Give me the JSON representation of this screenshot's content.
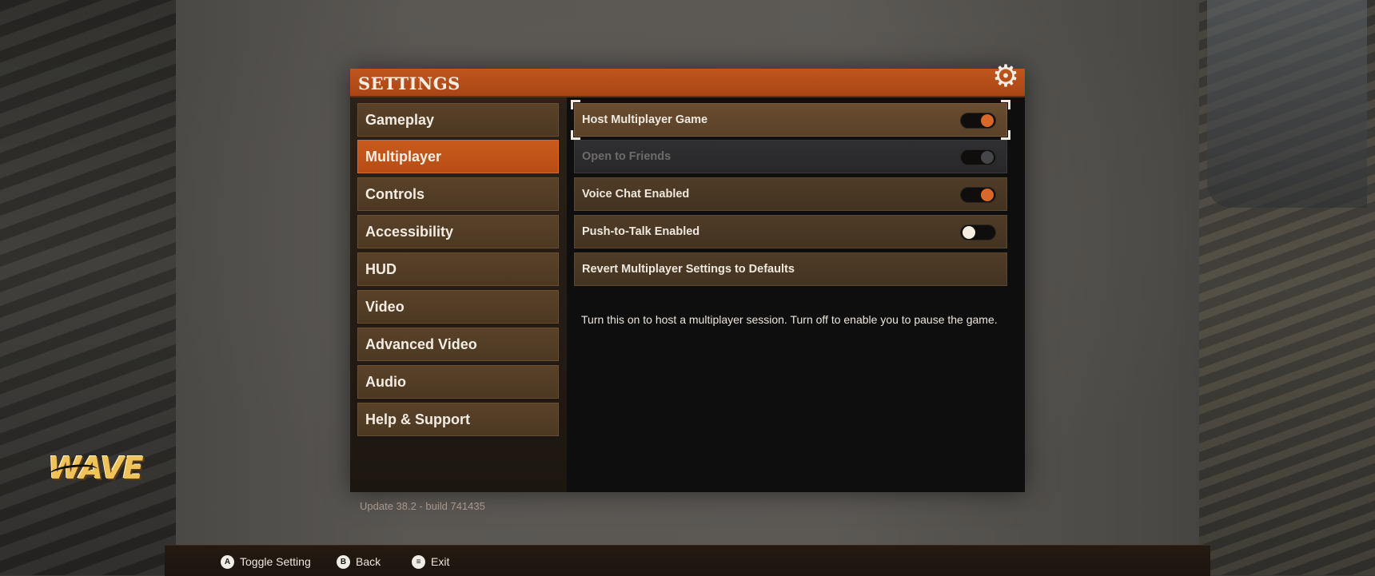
{
  "header": {
    "title": "SETTINGS",
    "gear_icon": "gear-icon"
  },
  "nav": {
    "items": [
      {
        "label": "Gameplay",
        "selected": false
      },
      {
        "label": "Multiplayer",
        "selected": true
      },
      {
        "label": "Controls",
        "selected": false
      },
      {
        "label": "Accessibility",
        "selected": false
      },
      {
        "label": "HUD",
        "selected": false
      },
      {
        "label": "Video",
        "selected": false
      },
      {
        "label": "Advanced Video",
        "selected": false
      },
      {
        "label": "Audio",
        "selected": false
      },
      {
        "label": "Help & Support",
        "selected": false
      }
    ],
    "version": "Update 38.2 - build 741435"
  },
  "settings": {
    "rows": [
      {
        "label": "Host Multiplayer Game",
        "toggle": "on",
        "state": "focused"
      },
      {
        "label": "Open to Friends",
        "toggle": "on",
        "state": "disabled"
      },
      {
        "label": "Voice Chat Enabled",
        "toggle": "on",
        "state": "normal"
      },
      {
        "label": "Push-to-Talk Enabled",
        "toggle": "off",
        "state": "normal"
      },
      {
        "label": "Revert Multiplayer Settings to Defaults",
        "toggle": null,
        "state": "normal"
      }
    ],
    "description": "Turn this on to host a multiplayer session. Turn off to enable you to pause the game."
  },
  "logo": {
    "text": "WAVE"
  },
  "footer": {
    "hints": [
      {
        "glyph": "A",
        "label": "Toggle Setting",
        "icon": "a-button-icon"
      },
      {
        "glyph": "B",
        "label": "Back",
        "icon": "b-button-icon"
      },
      {
        "glyph": "≡",
        "label": "Exit",
        "icon": "menu-button-icon"
      }
    ]
  },
  "colors": {
    "accent": "#c0561e",
    "toggle_on": "#d7682a",
    "nav_item": "#4c3822",
    "panel_bg": "#111010"
  }
}
